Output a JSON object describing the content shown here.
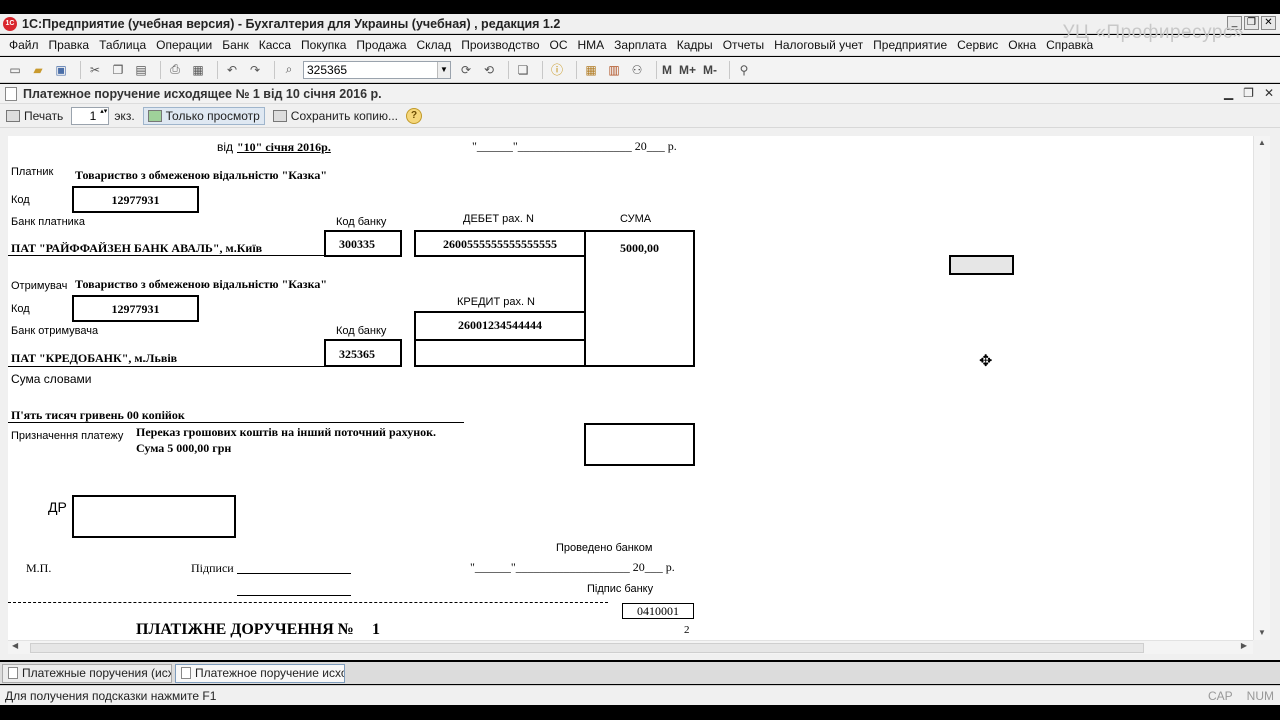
{
  "window": {
    "title": "1С:Предприятие (учебная версия) - Бухгалтерия для Украины (учебная) , редакция 1.2",
    "app_icon_text": "1C",
    "watermark": "УЦ «Профиресурс»"
  },
  "menu": [
    "Файл",
    "Правка",
    "Таблица",
    "Операции",
    "Банк",
    "Касса",
    "Покупка",
    "Продажа",
    "Склад",
    "Производство",
    "ОС",
    "НМА",
    "Зарплата",
    "Кадры",
    "Отчеты",
    "Налоговый учет",
    "Предприятие",
    "Сервис",
    "Окна",
    "Справка"
  ],
  "toolbar": {
    "search_value": "325365",
    "m_labels": [
      "M",
      "M+",
      "M-"
    ]
  },
  "document": {
    "title": "Платежное поручение исходящее № 1 від 10 січня 2016 р.",
    "print_label": "Печать",
    "copies": "1",
    "copies_unit": "экз.",
    "view_only_label": "Только просмотр",
    "save_copy_label": "Сохранить копию..."
  },
  "form": {
    "date_prefix": "від",
    "date_value": "\"10\" січня 2016р.",
    "date_right": "\"______\"___________________ 20___ р.",
    "payer_label": "Платник",
    "payer_name": "Товариство з обмеженою відальністю \"Казка\"",
    "code_label": "Код",
    "payer_code": "12977931",
    "payer_bank_label": "Банк платника",
    "bank_code_label": "Код банку",
    "debit_label": "ДЕБЕТ рах. N",
    "sum_label": "СУМА",
    "payer_bank": "ПАТ \"РАЙФФАЙЗЕН БАНК АВАЛЬ\", м.Київ",
    "payer_bank_code": "300335",
    "debit_account": "2600555555555555555",
    "sum_value": "5000,00",
    "recipient_label": "Отримувач",
    "recipient_name": "Товариство з обмеженою відальністю \"Казка\"",
    "recipient_code": "12977931",
    "credit_label": "КРЕДИТ рах. N",
    "credit_account": "26001234544444",
    "recipient_bank_label": "Банк отримувача",
    "recipient_bank": "ПАТ \"КРЕДОБАНК\", м.Львів",
    "recipient_bank_code": "325365",
    "words_label": "Сума словами",
    "words_value": "П'ять тисяч гривень 00 копійок",
    "purpose_label": "Призначення платежу",
    "purpose_line1": "Переказ грошових коштів на інший поточний рахунок.",
    "purpose_line2": "Сума 5 000,00 грн",
    "dr_label": "ДР",
    "processed_label": "Проведено банком",
    "mp_label": "М.П.",
    "signatures_label": "Підписи",
    "bank_signature_label": "Підпис банку",
    "form_code": "0410001",
    "next_title": "ПЛАТІЖНЕ ДОРУЧЕННЯ №",
    "next_number": "1",
    "page_num": "2"
  },
  "tabs": [
    "Платежные поручения (исх...",
    "Платежное поручение исхо..."
  ],
  "status": {
    "hint": "Для получения подсказки нажмите F1",
    "cap": "CAP",
    "num": "NUM"
  }
}
